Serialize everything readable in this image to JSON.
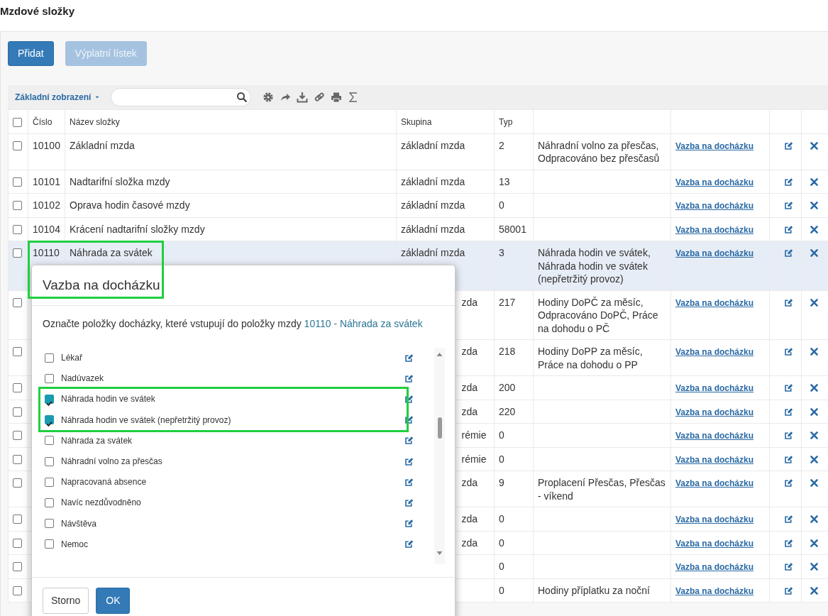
{
  "page": {
    "title": "Mzdové složky"
  },
  "actions": [
    {
      "label": "Přidat",
      "disabled": false
    },
    {
      "label": "Výplatní lístek",
      "disabled": true
    }
  ],
  "toolbar": {
    "view": "Základní zobrazení",
    "tools": [
      {
        "kind": "settings"
      },
      {
        "kind": "share"
      },
      {
        "kind": "download"
      },
      {
        "kind": "link"
      },
      {
        "kind": "print"
      },
      {
        "kind": "sum"
      }
    ]
  },
  "table": {
    "header_checked": false,
    "columns": [
      "Číslo",
      "Název složky",
      "Skupina",
      "Typ"
    ],
    "rows": [
      {
        "covered": false,
        "checked": false,
        "selected": false,
        "number": "10100",
        "name": "Základní mzda",
        "group": "základní mzda",
        "type": "2",
        "description": "Náhradní volno za přesčas, Odpracováno bez přesčasů",
        "link": "Vazba na docházku"
      },
      {
        "covered": false,
        "checked": false,
        "selected": false,
        "number": "10101",
        "name": "Nadtarifní složka mzdy",
        "group": "základní mzda",
        "type": "13",
        "link": "Vazba na docházku"
      },
      {
        "covered": false,
        "checked": false,
        "selected": false,
        "number": "10102",
        "name": "Oprava hodin časové mzdy",
        "group": "základní mzda",
        "type": "0",
        "link": "Vazba na docházku"
      },
      {
        "covered": false,
        "checked": false,
        "selected": false,
        "number": "10104",
        "name": "Krácení nadtarifní složky mzdy",
        "group": "základní mzda",
        "type": "58001",
        "link": "Vazba na docházku"
      },
      {
        "covered": false,
        "checked": false,
        "selected": true,
        "number": "10110",
        "name": "Náhrada za svátek",
        "group": "základní mzda",
        "type": "3",
        "description": "Náhrada hodin ve svátek, Náhrada hodin ve svátek (nepřetržitý provoz)",
        "link": "Vazba na docházku"
      },
      {
        "covered": true,
        "checked": false,
        "selected": false,
        "group": "zda",
        "type": "217",
        "description": "Hodiny DoPČ za měsíc, Odpracováno DoPČ, Práce na dohodu o PČ",
        "link": "Vazba na docházku"
      },
      {
        "covered": true,
        "checked": false,
        "selected": false,
        "group": "zda",
        "type": "218",
        "description": "Hodiny DoPP za měsíc, Práce na dohodu o PP",
        "link": "Vazba na docházku"
      },
      {
        "covered": true,
        "checked": false,
        "selected": false,
        "group": "zda",
        "type": "200",
        "link": "Vazba na docházku"
      },
      {
        "covered": true,
        "checked": false,
        "selected": false,
        "group": "zda",
        "type": "220",
        "link": "Vazba na docházku"
      },
      {
        "covered": true,
        "checked": false,
        "selected": false,
        "group": "rémie",
        "type": "0",
        "link": "Vazba na docházku"
      },
      {
        "covered": true,
        "checked": false,
        "selected": false,
        "group": "rémie",
        "type": "0",
        "link": "Vazba na docházku"
      },
      {
        "covered": true,
        "checked": false,
        "selected": false,
        "group": "zda",
        "type": "9",
        "description": "Proplacení Přesčas, Přesčas - víkend",
        "link": "Vazba na docházku"
      },
      {
        "covered": true,
        "checked": false,
        "selected": false,
        "group": "zda",
        "type": "0",
        "link": "Vazba na docházku"
      },
      {
        "covered": true,
        "checked": false,
        "selected": false,
        "group": "zda",
        "type": "0",
        "link": "Vazba na docházku"
      },
      {
        "covered": true,
        "checked": false,
        "selected": false,
        "type": "0",
        "link": "Vazba na docházku"
      },
      {
        "covered": true,
        "checked": false,
        "selected": false,
        "type": "0",
        "description": "Hodiny příplatku za noční",
        "link": "Vazba na docházku"
      }
    ]
  },
  "dialog": {
    "title": "Vazba na docházku",
    "intro": "Označte položky docházky, které vstupují do položky mzdy ",
    "intro_link": "10110 - Náhrada za svátek",
    "items": [
      {
        "label": "Lékař",
        "checked": false
      },
      {
        "label": "Nadúvazek",
        "checked": false
      },
      {
        "label": "Náhrada hodin ve svátek",
        "checked": true
      },
      {
        "label": "Náhrada hodin ve svátek (nepřetržitý provoz)",
        "checked": true
      },
      {
        "label": "Náhrada za svátek",
        "checked": false
      },
      {
        "label": "Náhradní volno za přesčas",
        "checked": false
      },
      {
        "label": "Napracovaná absence",
        "checked": false
      },
      {
        "label": "Navíc nezdůvodněno",
        "checked": false
      },
      {
        "label": "Návštěva",
        "checked": false
      },
      {
        "label": "Nemoc",
        "checked": false
      }
    ],
    "buttons": [
      {
        "label": "Storno",
        "kind": "secondary"
      },
      {
        "label": "OK",
        "kind": "primary"
      }
    ]
  },
  "highlight_frames": {
    "selected_row": true,
    "checked_items": true
  }
}
